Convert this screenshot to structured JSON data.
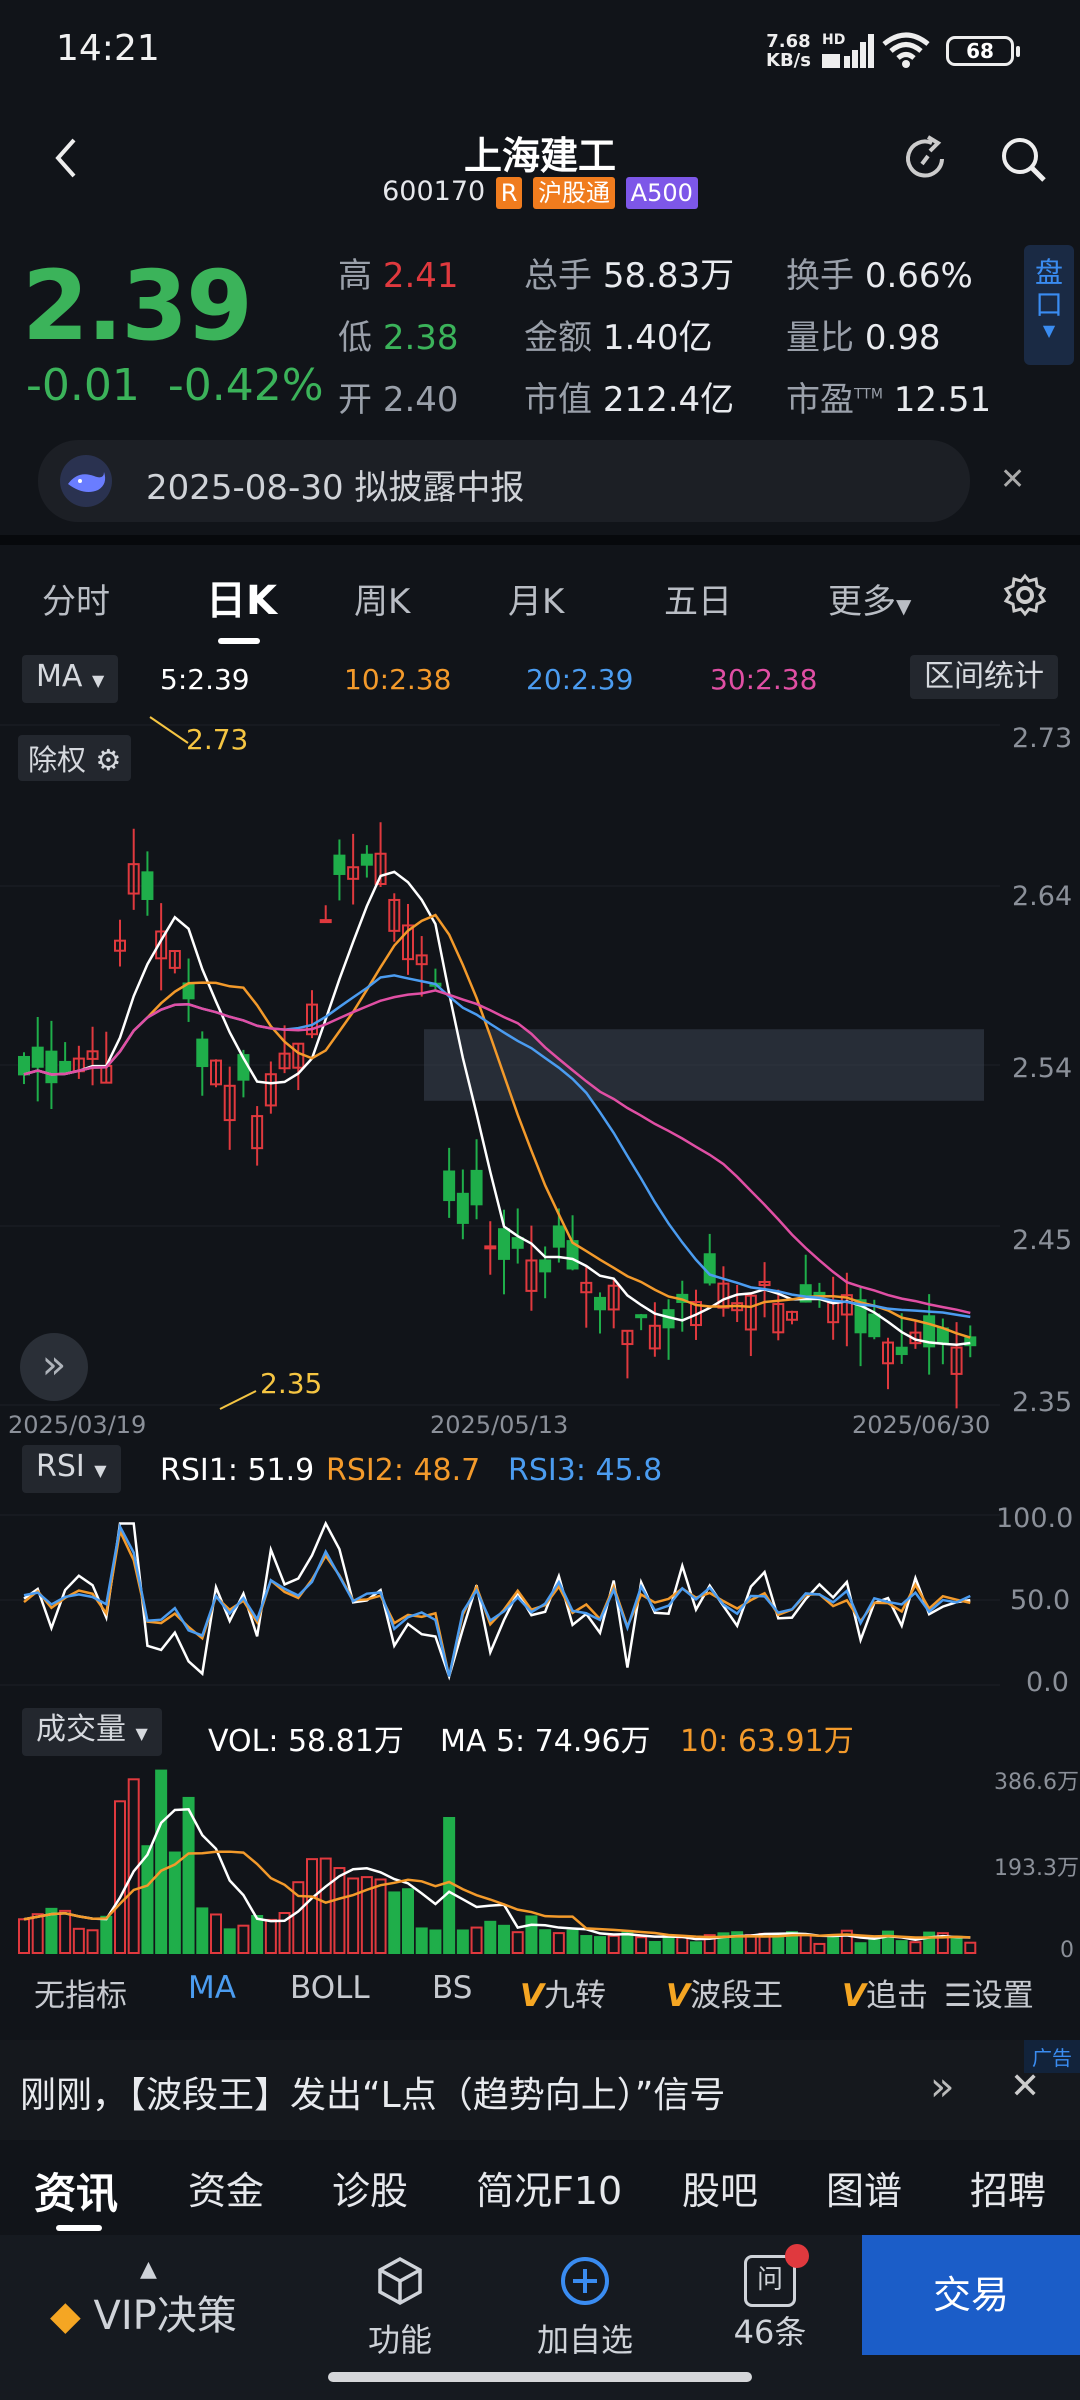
{
  "status_bar": {
    "time": "14:21",
    "net_speed_value": "7.68",
    "net_speed_unit": "KB/s",
    "hd": "HD",
    "battery": "68"
  },
  "header": {
    "title": "上海建工",
    "code": "600170",
    "tag_r": "R",
    "tag_hgt": "沪股通",
    "tag_a500": "A500"
  },
  "quote": {
    "price": "2.39",
    "change": "-0.01",
    "change_pct": "-0.42%",
    "high_label": "高",
    "high": "2.41",
    "low_label": "低",
    "low": "2.38",
    "open_label": "开",
    "open": "2.40",
    "vol_label": "总手",
    "vol": "58.83万",
    "amount_label": "金额",
    "amount": "1.40亿",
    "mcap_label": "市值",
    "mcap": "212.4亿",
    "turnover_label": "换手",
    "turnover": "0.66%",
    "volratio_label": "量比",
    "volratio": "0.98",
    "pe_label": "市盈",
    "pe_sup": "TTM",
    "pe": "12.51",
    "pankou": [
      "盘",
      "口"
    ]
  },
  "notice": {
    "text": "2025-08-30 拟披露中报"
  },
  "period_tabs": [
    "分时",
    "日K",
    "周K",
    "月K",
    "五日",
    "更多"
  ],
  "ma_bar": {
    "selector": "MA",
    "ma5": "5:2.39",
    "ma10": "10:2.38",
    "ma20": "20:2.39",
    "ma30": "30:2.38",
    "range_stats": "区间统计"
  },
  "kline": {
    "chuquan": "除权",
    "y_ticks": [
      "2.73",
      "2.64",
      "2.54",
      "2.45",
      "2.35"
    ],
    "x_ticks": [
      "2025/03/19",
      "2025/05/13",
      "2025/06/30"
    ],
    "max_label": "2.73",
    "min_label": "2.35"
  },
  "rsi_bar": {
    "selector": "RSI",
    "rsi1": "RSI1: 51.9",
    "rsi2": "RSI2: 48.7",
    "rsi3": "RSI3: 45.8",
    "ticks": [
      "100.0",
      "50.0",
      "0.0"
    ]
  },
  "vol_bar": {
    "selector": "成交量",
    "vol": "VOL: 58.81万",
    "ma5": "MA 5: 74.96万",
    "ma10": "10: 63.91万",
    "ticks": [
      "386.6万",
      "193.3万",
      "0"
    ]
  },
  "indicators": [
    "无指标",
    "MA",
    "BOLL",
    "BS",
    "九转",
    "波段王",
    "追击",
    "设置"
  ],
  "ad": {
    "text": "刚刚，【波段王】发出“L点（趋势向上）”信号",
    "tag": "广告"
  },
  "info_tabs": [
    "资讯",
    "资金",
    "诊股",
    "简况F10",
    "股吧",
    "图谱",
    "招聘"
  ],
  "bottom_bar": {
    "vip": "VIP决策",
    "func": "功能",
    "add": "加自选",
    "ask": "问",
    "ask_count": "46条",
    "trade": "交易"
  },
  "colors": {
    "up": "#e0393e",
    "down": "#1fae4a",
    "ma5": "#ffffff",
    "ma10": "#f39a2b",
    "ma20": "#4b9cf0",
    "ma30": "#e04fa4",
    "accent": "#1b5dc8"
  },
  "chart_data": {
    "type": "candlestick",
    "x": [
      "2025/03/19",
      "2025/05/13",
      "2025/06/30"
    ],
    "ylim": [
      2.35,
      2.73
    ],
    "series": [
      {
        "name": "5",
        "last": 2.39
      },
      {
        "name": "10",
        "last": 2.38
      },
      {
        "name": "20",
        "last": 2.39
      },
      {
        "name": "30",
        "last": 2.38
      }
    ],
    "annotations": {
      "max": 2.73,
      "min": 2.35
    }
  }
}
